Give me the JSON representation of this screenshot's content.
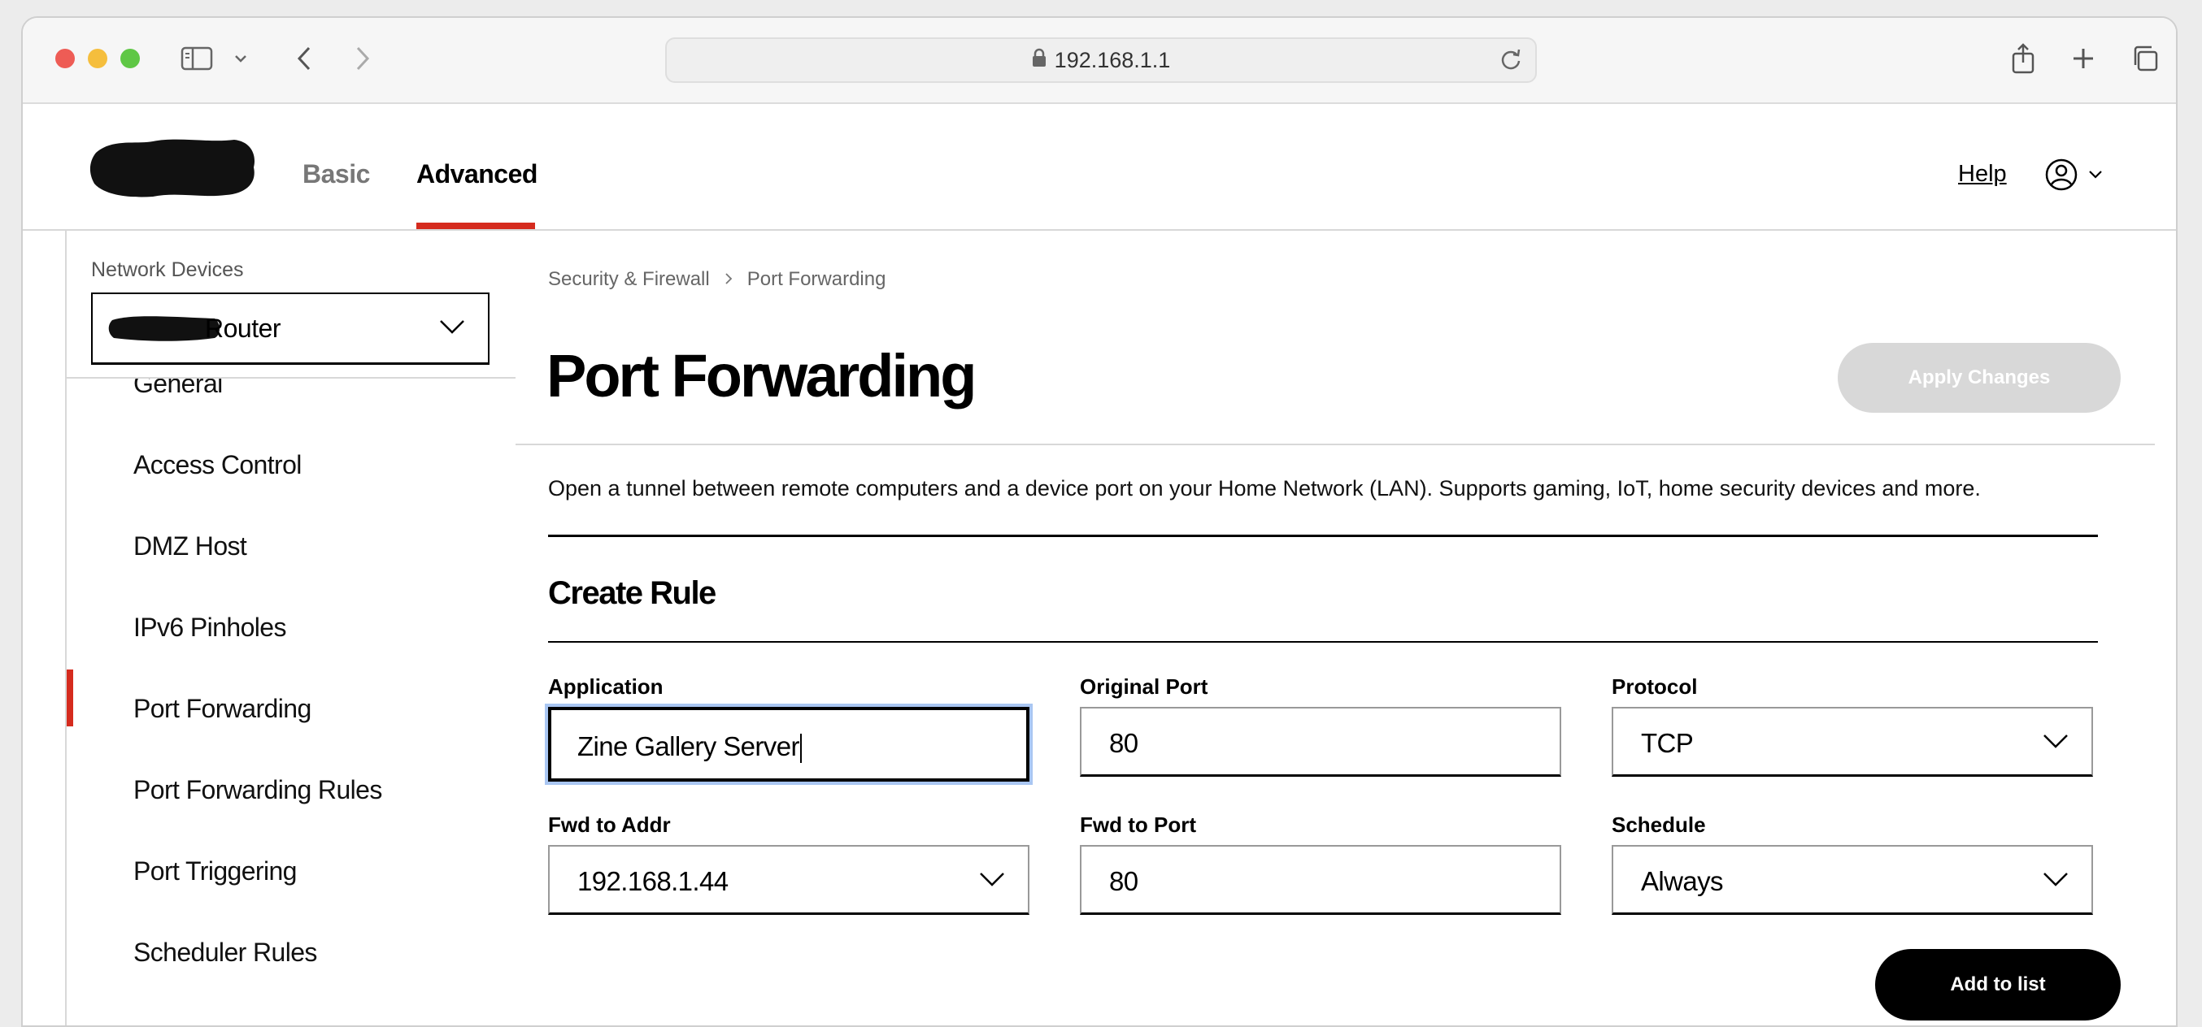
{
  "browser": {
    "url": "192.168.1.1"
  },
  "nav": {
    "tabs": [
      {
        "label": "Basic",
        "active": false
      },
      {
        "label": "Advanced",
        "active": true
      }
    ],
    "help_label": "Help",
    "accent_color": "#d52b1e"
  },
  "sidebar": {
    "network_devices_label": "Network Devices",
    "device_select_value": "Router",
    "items": [
      {
        "label": "General",
        "active": false
      },
      {
        "label": "Access Control",
        "active": false
      },
      {
        "label": "DMZ Host",
        "active": false
      },
      {
        "label": "IPv6 Pinholes",
        "active": false
      },
      {
        "label": "Port Forwarding",
        "active": true
      },
      {
        "label": "Port Forwarding Rules",
        "active": false
      },
      {
        "label": "Port Triggering",
        "active": false
      },
      {
        "label": "Scheduler Rules",
        "active": false
      }
    ]
  },
  "main": {
    "breadcrumb": [
      "Security & Firewall",
      "Port Forwarding"
    ],
    "title": "Port Forwarding",
    "apply_label": "Apply Changes",
    "description": "Open a tunnel between remote computers and a device port on your Home Network (LAN). Supports gaming, IoT, home security devices and more.",
    "section_title": "Create Rule",
    "form": {
      "application": {
        "label": "Application",
        "value": "Zine Gallery Server"
      },
      "original_port": {
        "label": "Original Port",
        "value": "80"
      },
      "protocol": {
        "label": "Protocol",
        "value": "TCP"
      },
      "fwd_addr": {
        "label": "Fwd to Addr",
        "value": "192.168.1.44"
      },
      "fwd_port": {
        "label": "Fwd to Port",
        "value": "80"
      },
      "schedule": {
        "label": "Schedule",
        "value": "Always"
      }
    },
    "add_label": "Add to list"
  }
}
